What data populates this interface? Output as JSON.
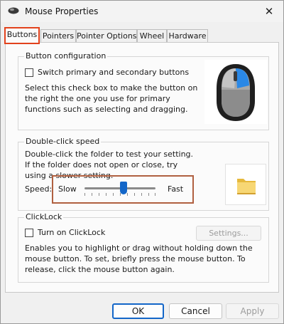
{
  "window": {
    "title": "Mouse Properties",
    "close_glyph": "✕"
  },
  "tabs": [
    {
      "label": "Buttons",
      "active": true
    },
    {
      "label": "Pointers",
      "active": false
    },
    {
      "label": "Pointer Options",
      "active": false
    },
    {
      "label": "Wheel",
      "active": false
    },
    {
      "label": "Hardware",
      "active": false
    }
  ],
  "button_config": {
    "title": "Button configuration",
    "switch_label": "Switch primary and secondary buttons",
    "switch_checked": false,
    "description": "Select this check box to make the button on the right the one you use for primary functions such as selecting and dragging."
  },
  "double_click": {
    "title": "Double-click speed",
    "description": "Double-click the folder to test your setting. If the folder does not open or close, try using a slower setting.",
    "speed_label": "Speed:",
    "slow_label": "Slow",
    "fast_label": "Fast",
    "slider_value": 0.55
  },
  "clicklock": {
    "title": "ClickLock",
    "turn_on_label": "Turn on ClickLock",
    "turn_on_checked": false,
    "settings_label": "Settings...",
    "description": "Enables you to highlight or drag without holding down the mouse button. To set, briefly press the mouse button. To release, click the mouse button again."
  },
  "footer": {
    "ok": "OK",
    "cancel": "Cancel",
    "apply": "Apply"
  },
  "colors": {
    "accent": "#1366c8",
    "highlight_red": "#e2421c",
    "highlight_brown": "#b06040"
  }
}
